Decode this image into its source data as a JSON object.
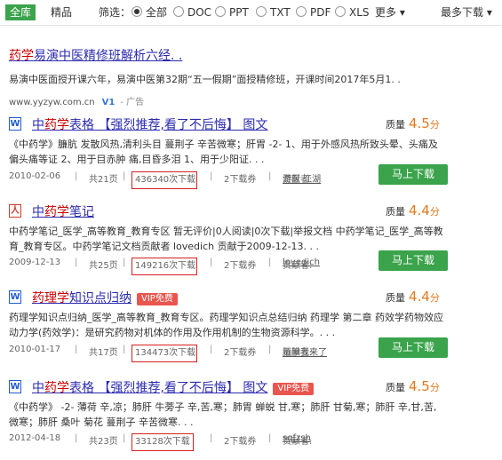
{
  "filter": {
    "tab_all": "全库",
    "tab_quality": "精品",
    "label": "筛选：",
    "options": [
      "全部",
      "DOC",
      "PPT",
      "TXT",
      "PDF",
      "XLS"
    ],
    "selected": "全部",
    "more": "更多 ▾",
    "sort": "最多下载 ▾"
  },
  "ad": {
    "title_hl": "药学",
    "title_rest": "易演中医精修班解析六经. .",
    "desc": "易演中医面授开课六年，易演中医第32期“五一假期”面授精修班，开课时间2017年5月1. .",
    "url": "www.yyzyw.com.cn",
    "v1": "V1",
    "ad_label": "- 广告"
  },
  "results": [
    {
      "icon": "W",
      "title_pre": "中",
      "title_hl": "药学",
      "title_post": "表格 【强烈推荐,看了不后悔】 图文",
      "vip": "",
      "quality_label": "质量",
      "score": "4.5",
      "score_unit": "分",
      "desc": "《中药学》臁肮 发散风热,清利头目 蔓荆子 辛苦微寒；肝胃 -2- 1、用于外感风热所致头晕、头痛及偏头痛等证 2、用于目赤肿 痛,目昏多泪 1、用于少阳证. . .",
      "date": "2010-02-06",
      "pages": "共21页",
      "downloads": "436340次下载",
      "coupon": "2下载券",
      "contributor_label": "贡献者:",
      "contributor": "游医 江湖",
      "button": "马上下载"
    },
    {
      "icon": "人",
      "title_pre": "中",
      "title_hl": "药学",
      "title_post": "笔记",
      "vip": "",
      "quality_label": "质量",
      "score": "4.4",
      "score_unit": "分",
      "desc": "中药学笔记_医学_高等教育_教育专区 暂无评价|0人阅读|0次下载|举报文档 中药学笔记_医学_高等教育_教育专区。中药学笔记文档贡献者 lovedich 贡献于2009-12-13. . .",
      "date": "2009-12-13",
      "pages": "共25页",
      "downloads": "149216次下载",
      "coupon": "2下载券",
      "contributor_label": "贡献者:",
      "contributor": "lovedich",
      "button": "马上下载"
    },
    {
      "icon": "W",
      "title_pre": "",
      "title_hl": "药理学",
      "title_post": "知识点归纳",
      "vip": "VIP免费",
      "quality_label": "质量",
      "score": "4.4",
      "score_unit": "分",
      "desc": "药理学知识点归纳_医学_高等教育_教育专区。药理学知识点总结归纳 药理学 第二章 药效学药物效应动力学(药效学)：是研究药物对机体的作用及作用机制的生物资源科学。. . .",
      "date": "2010-01-17",
      "pages": "共17页",
      "downloads": "134473次下载",
      "coupon": "2下载券",
      "contributor_label": "贡献者:",
      "contributor": "腼腆我来了",
      "button": "马上下载"
    },
    {
      "icon": "W",
      "title_pre": "中",
      "title_hl": "药学",
      "title_post": "表格 【强烈推荐,看了不后悔】 图文",
      "vip": "VIP免费",
      "quality_label": "质量",
      "score": "4.5",
      "score_unit": "分",
      "desc": "《中药学》 -2- 薄荷 辛,凉；肺肝 牛蒡子 辛,苦,寒；肺胃 蝉蜕 甘,寒；肺肝 甘菊,寒；肺肝 辛,甘,苦,微寒；肺肝 桑叶 菊花 蔓荆子 辛苦微寒. . .",
      "date": "2012-04-18",
      "pages": "共23页",
      "downloads": "33128次下载",
      "coupon": "2下载券",
      "contributor_label": "贡献者:",
      "contributor": "sqfzsh",
      "button": "马上下载"
    }
  ]
}
